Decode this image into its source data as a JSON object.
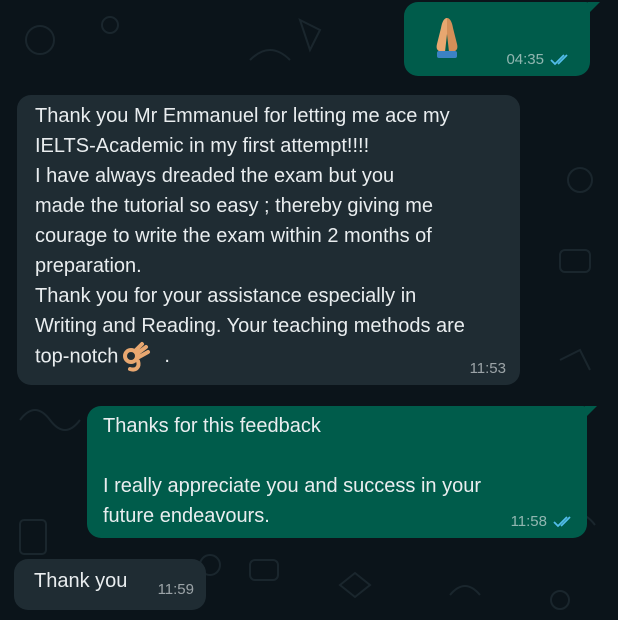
{
  "colors": {
    "background": "#0b141a",
    "incoming_bubble": "#1f2c33",
    "outgoing_bubble": "#005c4b",
    "text": "#e9edef",
    "read_ticks": "#53bdeb"
  },
  "messages": [
    {
      "direction": "outgoing",
      "emoji": "folded-hands",
      "time": "04:35",
      "status": "read"
    },
    {
      "direction": "incoming",
      "text": "Thank you Mr Emmanuel for letting me ace my\nIELTS-Academic in my first attempt!!!!\nI have always dreaded the exam but you\nmade the tutorial so easy ; thereby giving me\ncourage to write the exam within 2 months of\npreparation.\nThank you for your assistance especially in\nWriting and Reading. Your teaching methods are\ntop-notch",
      "trailing_emoji": "ok-hand",
      "trailing_text": ".",
      "time": "11:53"
    },
    {
      "direction": "outgoing",
      "text": "Thanks for this feedback\n\nI really appreciate you and success in your\nfuture endeavours.",
      "time": "11:58",
      "status": "read"
    },
    {
      "direction": "incoming",
      "text": "Thank you",
      "time": "11:59"
    }
  ]
}
